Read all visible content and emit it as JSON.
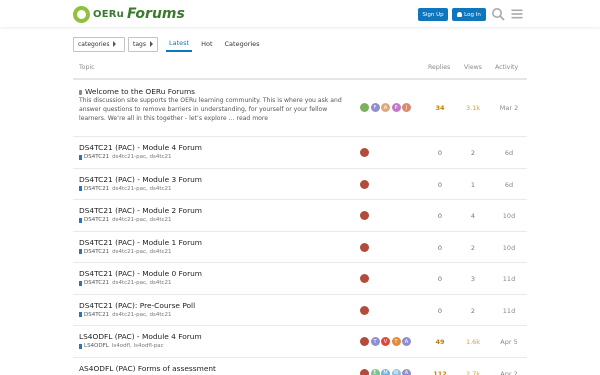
{
  "header": {
    "logo_oer": "OERu",
    "logo_forums": "Forums",
    "signup_label": "Sign Up",
    "login_label": "Log In",
    "colors": {
      "brand": "#3a7a2f",
      "accent": "#0e76bd",
      "logo_ring": "#8fc13e"
    }
  },
  "nav": {
    "categories_label": "categories",
    "tags_label": "tags",
    "tabs": [
      {
        "label": "Latest",
        "active": true
      },
      {
        "label": "Hot",
        "active": false
      },
      {
        "label": "Categories",
        "active": false
      }
    ]
  },
  "table": {
    "headers": {
      "topic": "Topic",
      "replies": "Replies",
      "views": "Views",
      "activity": "Activity"
    },
    "pinned": {
      "title": "Welcome to the OERu Forums",
      "excerpt": "This discussion site supports the OERu learning community. This is where you ask and answer questions to remove barriers in understanding, for yourself or your fellow learners. We’re all in this together - let’s explore …",
      "read_more": "read more",
      "replies": "34",
      "views": "3.1k",
      "activity": "Mar 2",
      "avatars": [
        {
          "letter": "",
          "color": "#7cb05a"
        },
        {
          "letter": "F",
          "color": "#8e8ed1"
        },
        {
          "letter": "A",
          "color": "#e3a87a"
        },
        {
          "letter": "P",
          "color": "#c279c9"
        },
        {
          "letter": "J",
          "color": "#d98a6a"
        }
      ]
    },
    "rows": [
      {
        "title": "DS4TC21 (PAC) - Module 4 Forum",
        "category": "DS4TC21",
        "tags": "ds4tc21-pac, ds4tc21",
        "replies": "0",
        "views": "2",
        "activity": "6d",
        "avatars": [
          {
            "letter": "",
            "color": "#b34b3d"
          }
        ]
      },
      {
        "title": "DS4TC21 (PAC) - Module 3 Forum",
        "category": "DS4TC21",
        "tags": "ds4tc21-pac, ds4tc21",
        "replies": "0",
        "views": "1",
        "activity": "6d",
        "avatars": [
          {
            "letter": "",
            "color": "#b34b3d"
          }
        ]
      },
      {
        "title": "DS4TC21 (PAC) - Module 2 Forum",
        "category": "DS4TC21",
        "tags": "ds4tc21-pac, ds4tc21",
        "replies": "0",
        "views": "4",
        "activity": "10d",
        "avatars": [
          {
            "letter": "",
            "color": "#b34b3d"
          }
        ]
      },
      {
        "title": "DS4TC21 (PAC) - Module 1 Forum",
        "category": "DS4TC21",
        "tags": "ds4tc21-pac, ds4tc21",
        "replies": "0",
        "views": "2",
        "activity": "10d",
        "avatars": [
          {
            "letter": "",
            "color": "#b34b3d"
          }
        ]
      },
      {
        "title": "DS4TC21 (PAC) - Module 0 Forum",
        "category": "DS4TC21",
        "tags": "ds4tc21-pac, ds4tc21",
        "replies": "0",
        "views": "3",
        "activity": "11d",
        "avatars": [
          {
            "letter": "",
            "color": "#b34b3d"
          }
        ]
      },
      {
        "title": "DS4TC21 (PAC): Pre-Course Poll",
        "category": "DS4TC21",
        "tags": "ds4tc21-pac, ds4tc21",
        "replies": "0",
        "views": "2",
        "activity": "11d",
        "avatars": [
          {
            "letter": "",
            "color": "#b34b3d"
          }
        ]
      },
      {
        "title": "LS4ODFL (PAC) - Module 4 Forum",
        "category": "LS4ODFL",
        "tags": "ls4odfl, ls4odfl-pac",
        "replies": "49",
        "views": "1.6k",
        "activity": "Apr 5",
        "avatars": [
          {
            "letter": "",
            "color": "#b34b3d"
          },
          {
            "letter": "T",
            "color": "#8e8ed1"
          },
          {
            "letter": "V",
            "color": "#d94a3d"
          },
          {
            "letter": "T",
            "color": "#e38a3d"
          },
          {
            "letter": "A",
            "color": "#8e8ed1"
          }
        ]
      },
      {
        "title": "AS4ODFL (PAC) Forms of assessment",
        "category": "",
        "tags": "",
        "replies": "112",
        "views": "2.7k",
        "activity": "Apr 2",
        "avatars": [
          {
            "letter": "",
            "color": "#b34b3d"
          },
          {
            "letter": "E",
            "color": "#7cc18f"
          },
          {
            "letter": "M",
            "color": "#6fb3d9"
          },
          {
            "letter": "W",
            "color": "#8fc1d9"
          },
          {
            "letter": "A",
            "color": "#8e8ed1"
          }
        ]
      }
    ]
  }
}
